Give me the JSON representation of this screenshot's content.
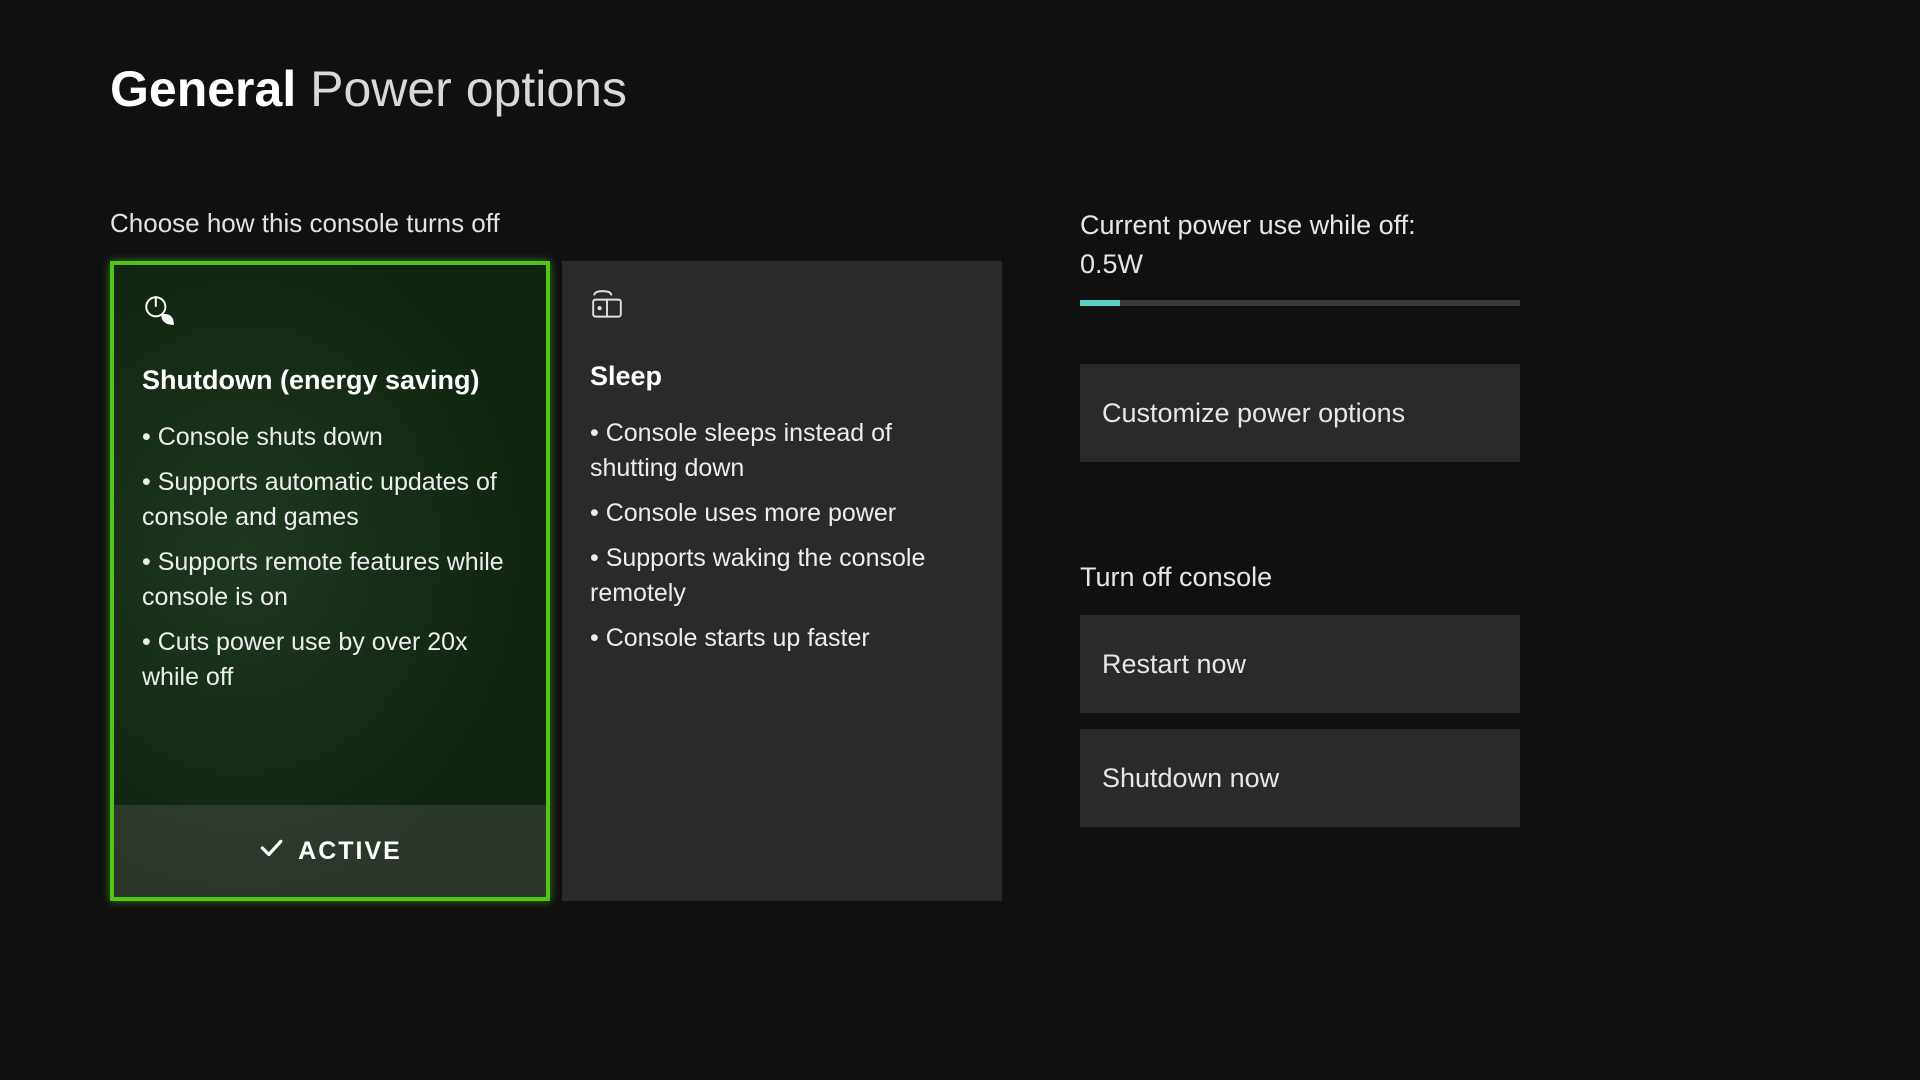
{
  "header": {
    "breadcrumb_bold": "General",
    "breadcrumb_rest": " Power options"
  },
  "section_label": "Choose how this console turns off",
  "cards": {
    "shutdown": {
      "title": "Shutdown (energy saving)",
      "bullets": [
        "Console shuts down",
        "Supports automatic updates of console and games",
        "Supports remote features while console is on",
        "Cuts power use by over 20x while off"
      ],
      "active_label": "ACTIVE"
    },
    "sleep": {
      "title": "Sleep",
      "bullets": [
        "Console sleeps instead of shutting down",
        "Console uses more power",
        "Supports waking the console remotely",
        "Console starts up faster"
      ]
    }
  },
  "right": {
    "status_line1": "Current power use while off:",
    "status_line2": "0.5W",
    "meter_pct": 9,
    "customize_btn": "Customize power options",
    "turn_off_heading": "Turn off console",
    "restart_btn": "Restart now",
    "shutdown_btn": "Shutdown now"
  }
}
